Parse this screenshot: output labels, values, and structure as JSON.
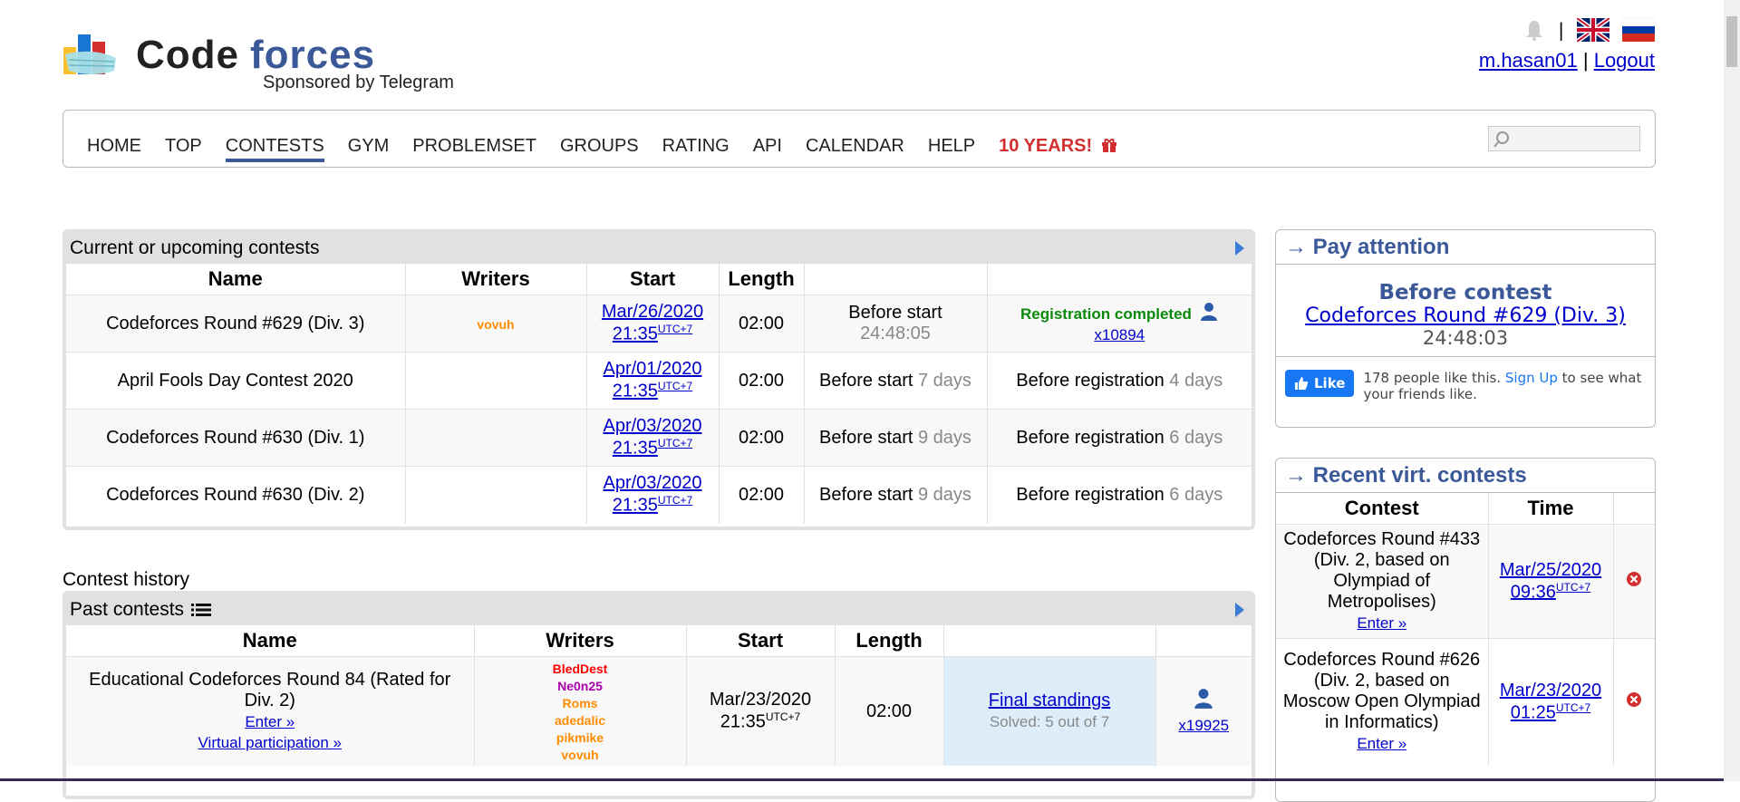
{
  "header": {
    "logo_code": "Code",
    "logo_forces": "forces",
    "sponsor": "Sponsored by Telegram",
    "username": "m.hasan01",
    "separator": "|",
    "logout": "Logout"
  },
  "menu": {
    "items": [
      "HOME",
      "TOP",
      "CONTESTS",
      "GYM",
      "PROBLEMSET",
      "GROUPS",
      "RATING",
      "API",
      "CALENDAR",
      "HELP"
    ],
    "special": "10 YEARS!",
    "active": "CONTESTS"
  },
  "current": {
    "title": "Current or upcoming contests",
    "headers": [
      "Name",
      "Writers",
      "Start",
      "Length",
      "",
      ""
    ],
    "rows": [
      {
        "name": "Codeforces Round #629 (Div. 3)",
        "writer": "vovuh",
        "date": "Mar/26/2020",
        "time": "21:35",
        "utc": "UTC+7",
        "length": "02:00",
        "before": "Before start",
        "before_val": "24:48:05",
        "reg": "Registration completed",
        "reg_count": "x10894"
      },
      {
        "name": "April Fools Day Contest 2020",
        "writer": "",
        "date": "Apr/01/2020",
        "time": "21:35",
        "utc": "UTC+7",
        "length": "02:00",
        "before": "Before start",
        "before_val": "7 days",
        "reg": "Before registration",
        "reg_val": "4 days"
      },
      {
        "name": "Codeforces Round #630 (Div. 1)",
        "writer": "",
        "date": "Apr/03/2020",
        "time": "21:35",
        "utc": "UTC+7",
        "length": "02:00",
        "before": "Before start",
        "before_val": "9 days",
        "reg": "Before registration",
        "reg_val": "6 days"
      },
      {
        "name": "Codeforces Round #630 (Div. 2)",
        "writer": "",
        "date": "Apr/03/2020",
        "time": "21:35",
        "utc": "UTC+7",
        "length": "02:00",
        "before": "Before start",
        "before_val": "9 days",
        "reg": "Before registration",
        "reg_val": "6 days"
      }
    ]
  },
  "history_heading": "Contest history",
  "past": {
    "title": "Past contests",
    "headers": [
      "Name",
      "Writers",
      "Start",
      "Length",
      "",
      ""
    ],
    "row": {
      "name": "Educational Codeforces Round 84 (Rated for Div. 2)",
      "enter": "Enter »",
      "virtual": "Virtual participation »",
      "writers": [
        "BledDest",
        "Ne0n25",
        "Roms",
        "adedalic",
        "pikmike",
        "vovuh"
      ],
      "start_date": "Mar/23/2020",
      "start_time": "21:35",
      "utc": "UTC+7",
      "length": "02:00",
      "standings": "Final standings",
      "solved": "Solved: 5 out of 7",
      "participants": "x19925"
    }
  },
  "pay": {
    "title": "→ Pay attention",
    "before": "Before contest",
    "contest": "Codeforces Round #629 (Div. 3)",
    "time": "24:48:03",
    "fb_like": "Like",
    "fb_text": "178 people like this.",
    "fb_signup": "Sign Up",
    "fb_rest": "to see what your friends like."
  },
  "recent": {
    "title": "→ Recent virt. contests",
    "headers": [
      "Contest",
      "Time",
      ""
    ],
    "rows": [
      {
        "contest": "Codeforces Round #433 (Div. 2, based on Olympiad of Metropolises)",
        "enter": "Enter »",
        "date": "Mar/25/2020",
        "time": "09:36",
        "utc": "UTC+7"
      },
      {
        "contest": "Codeforces Round #626 (Div. 2, based on Moscow Open Olympiad in Informatics)",
        "enter": "Enter »",
        "date": "Mar/23/2020",
        "time": "01:25",
        "utc": "UTC+7"
      }
    ]
  },
  "colors": {
    "brand": "#3b5998",
    "link": "#0000cc",
    "accent_red": "#d32f2f",
    "reg_green": "#0a8a0a"
  }
}
